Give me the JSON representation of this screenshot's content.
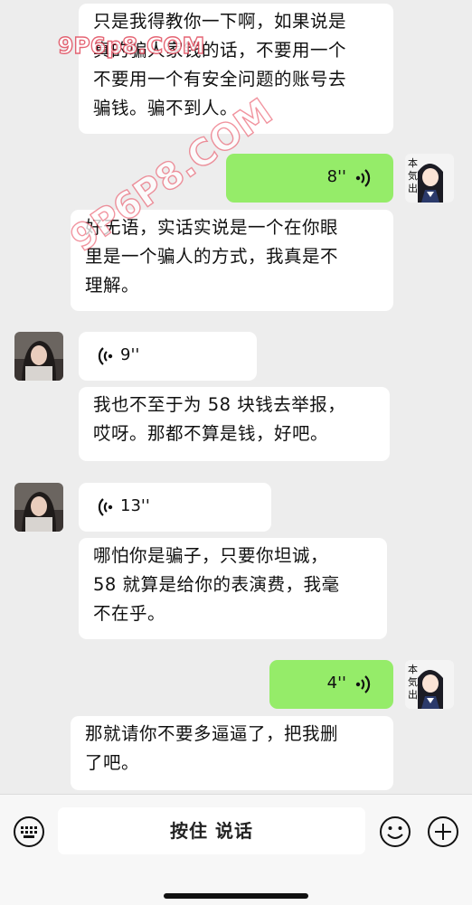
{
  "watermark": {
    "corner": "9P6p8.COM",
    "diagonal": "9P6P8.COM"
  },
  "messages": {
    "m1": "只是我得教你一下啊，如果说是\n真的骗人家钱的话，不要用一个\n不要用一个有安全问题的账号去\n骗钱。骗不到人。",
    "v1": "8''",
    "m2": "好无语，实话实说是一个在你眼\n里是一个骗人的方式，我真是不\n理解。",
    "v2": "9''",
    "m3": "我也不至于为 58 块钱去举报，\n哎呀。那都不算是钱，好吧。",
    "v3": "13''",
    "m4": "哪怕你是骗子，只要你坦诚，\n58 就算是给你的表演费，我毫\n不在乎。",
    "v4": "4''",
    "m5": "那就请你不要多逼逼了，把我删\n了吧。"
  },
  "input_bar": {
    "talk_label": "按住 说话",
    "keyboard_icon": "keyboard-icon",
    "emoji_icon": "emoji-icon",
    "plus_icon": "plus-icon"
  },
  "colors": {
    "sent_bubble": "#95ec69",
    "received_bubble": "#ffffff",
    "background": "#ededed"
  }
}
